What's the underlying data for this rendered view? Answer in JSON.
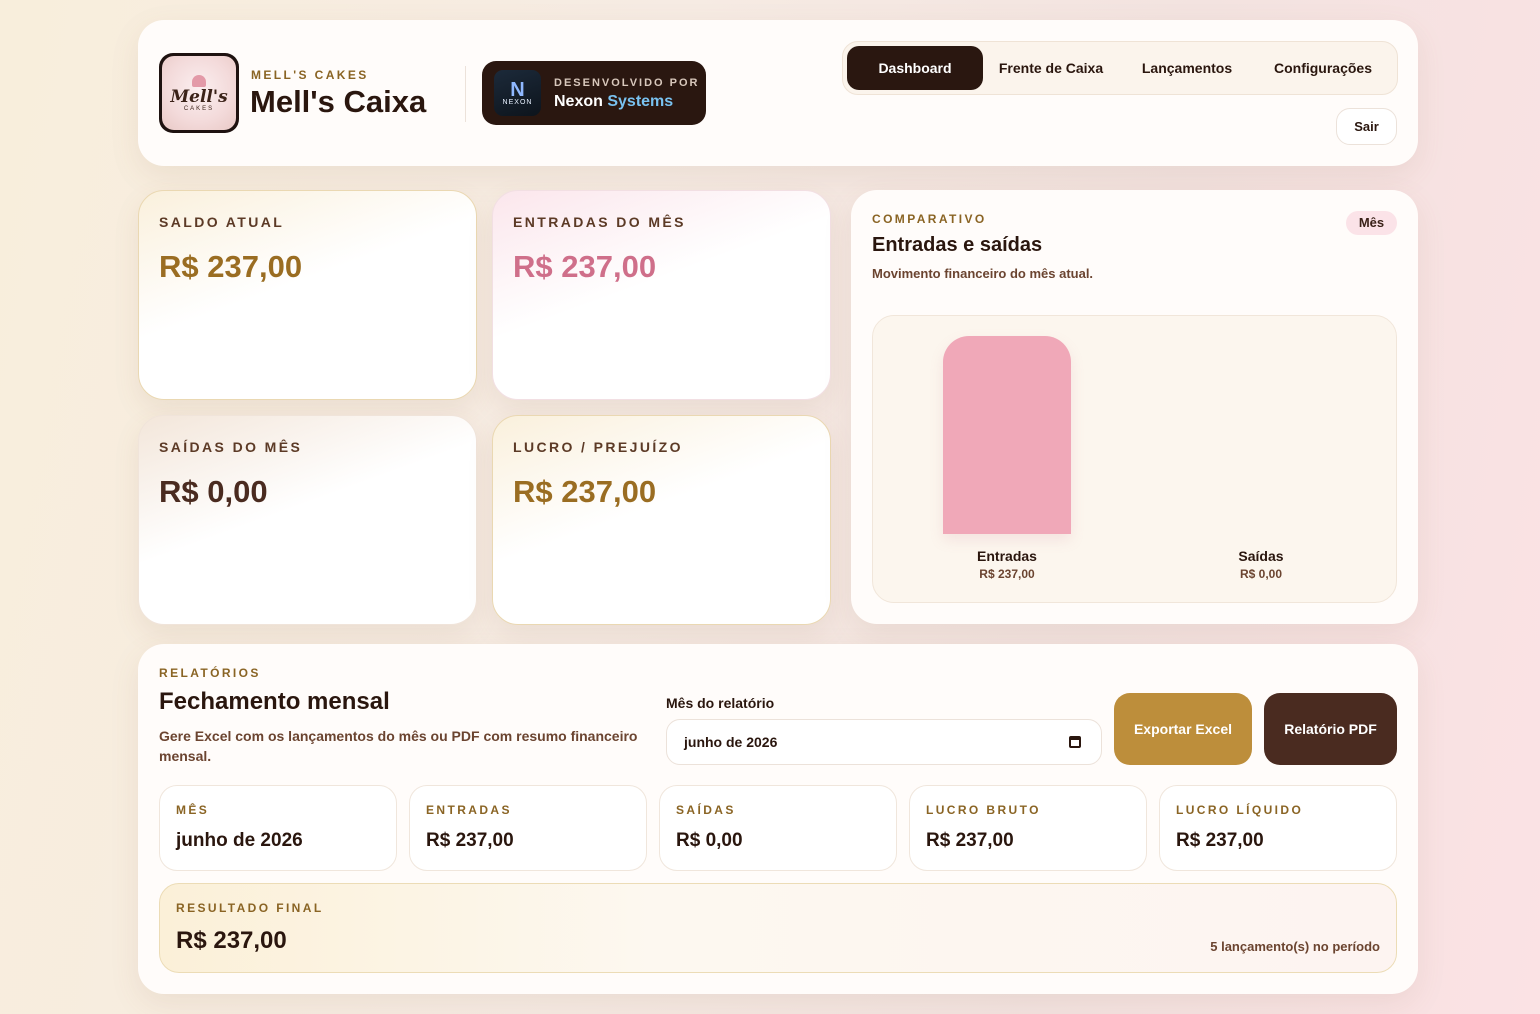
{
  "header": {
    "logo_text": "Mell's",
    "logo_sub": "CAKES",
    "brand_eyebrow": "MELL'S CAKES",
    "brand_title": "Mell's Caixa",
    "nexon": {
      "logo_letter": "N",
      "logo_text": "NEXON",
      "eyebrow": "DESENVOLVIDO POR",
      "name_part1": "Nexon",
      "name_part2": "Systems"
    },
    "nav": [
      {
        "label": "Dashboard",
        "active": true
      },
      {
        "label": "Frente de Caixa",
        "active": false
      },
      {
        "label": "Lançamentos",
        "active": false
      },
      {
        "label": "Configurações",
        "active": false
      }
    ],
    "logout_label": "Sair"
  },
  "stats": {
    "saldo": {
      "label": "SALDO ATUAL",
      "value": "R$ 237,00"
    },
    "entradas": {
      "label": "ENTRADAS DO MÊS",
      "value": "R$ 237,00"
    },
    "saidas": {
      "label": "SAÍDAS DO MÊS",
      "value": "R$ 0,00"
    },
    "lucro": {
      "label": "LUCRO / PREJUÍZO",
      "value": "R$ 237,00"
    }
  },
  "chart": {
    "eyebrow": "COMPARATIVO",
    "title": "Entradas e saídas",
    "subtitle": "Movimento financeiro do mês atual.",
    "pill": "Mês"
  },
  "chart_data": {
    "type": "bar",
    "categories": [
      "Entradas",
      "Saídas"
    ],
    "values": [
      237,
      0
    ],
    "value_labels": [
      "R$ 237,00",
      "R$ 0,00"
    ],
    "colors": [
      "#f0a8b8",
      "#c9a37a"
    ]
  },
  "report": {
    "eyebrow": "RELATÓRIOS",
    "title": "Fechamento mensal",
    "description": "Gere Excel com os lançamentos do mês ou PDF com resumo financeiro mensal.",
    "month_label": "Mês do relatório",
    "month_value": "junho de 2026",
    "excel_label": "Exportar Excel",
    "pdf_label": "Relatório PDF",
    "summary": [
      {
        "label": "MÊS",
        "value": "junho de 2026"
      },
      {
        "label": "ENTRADAS",
        "value": "R$ 237,00"
      },
      {
        "label": "SAÍDAS",
        "value": "R$ 0,00"
      },
      {
        "label": "LUCRO BRUTO",
        "value": "R$ 237,00"
      },
      {
        "label": "LUCRO LÍQUIDO",
        "value": "R$ 237,00"
      }
    ],
    "final_label": "RESULTADO FINAL",
    "final_value": "R$ 237,00",
    "final_count": "5 lançamento(s) no período"
  },
  "colors": {
    "gold": "#9a6d22",
    "pink": "#cf6f8a",
    "dark_brown": "#4a2b20",
    "excel_button": "#bd8e3b"
  }
}
